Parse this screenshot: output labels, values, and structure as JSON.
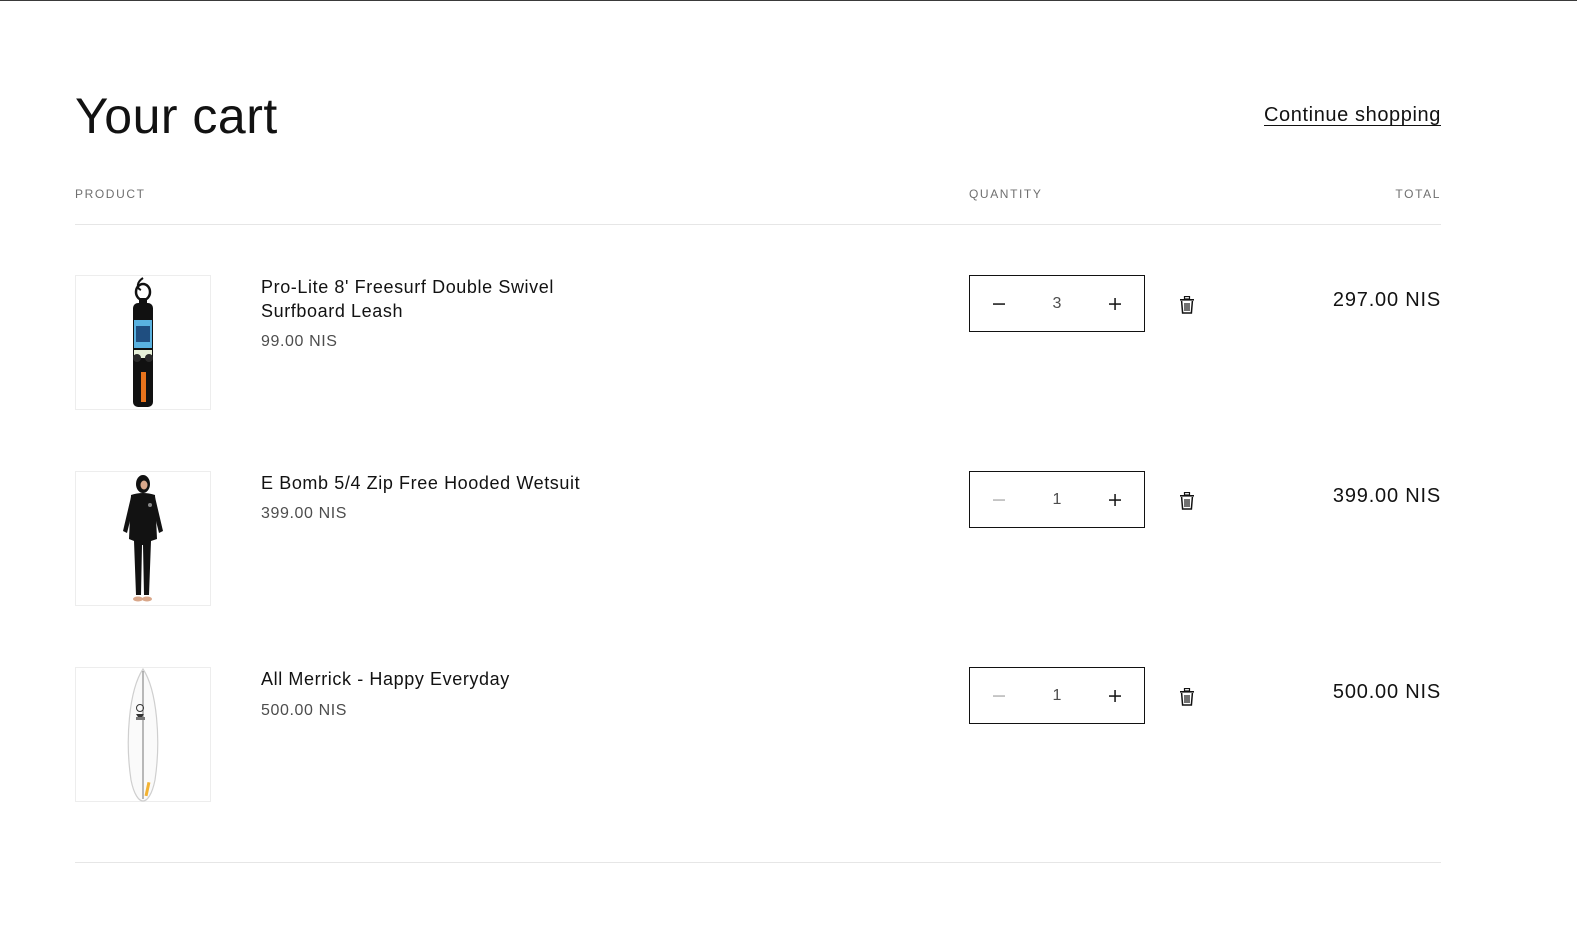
{
  "page": {
    "title": "Your cart",
    "continue_label": "Continue shopping"
  },
  "columns": {
    "product": "PRODUCT",
    "quantity": "QUANTITY",
    "total": "TOTAL"
  },
  "items": [
    {
      "name": "Pro-Lite 8' Freesurf Double Swivel Surfboard Leash",
      "unit_price": "99.00 NIS",
      "quantity": "3",
      "line_total": "297.00 NIS",
      "image_icon": "surf-leash-icon"
    },
    {
      "name": "E Bomb 5/4 Zip Free Hooded Wetsuit",
      "unit_price": "399.00 NIS",
      "quantity": "1",
      "line_total": "399.00 NIS",
      "image_icon": "wetsuit-icon"
    },
    {
      "name": "All Merrick - Happy Everyday",
      "unit_price": "500.00 NIS",
      "quantity": "1",
      "line_total": "500.00 NIS",
      "image_icon": "surfboard-icon"
    }
  ],
  "colors": {
    "text": "#121212",
    "muted": "#6f6f6f",
    "border": "#121212",
    "divider": "#e6e6e6",
    "disabled": "#b5b5b5"
  }
}
